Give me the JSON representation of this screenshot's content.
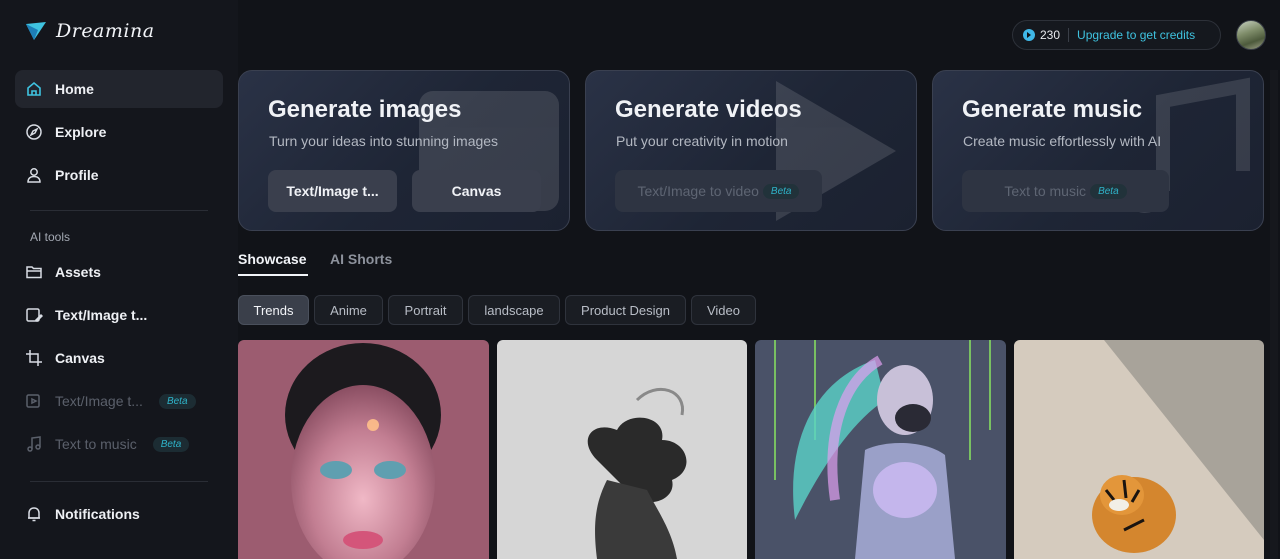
{
  "brand": {
    "name": "Dreamina"
  },
  "nav": {
    "home": "Home",
    "explore": "Explore",
    "profile": "Profile",
    "section_label": "AI tools",
    "assets": "Assets",
    "text_image": "Text/Image t...",
    "canvas": "Canvas",
    "text_image_video": "Text/Image t...",
    "text_music": "Text to music",
    "beta": "Beta",
    "notifications": "Notifications"
  },
  "account": {
    "credits": "230",
    "upgrade": "Upgrade to get credits"
  },
  "hero": {
    "images": {
      "title": "Generate images",
      "subtitle": "Turn your ideas into stunning images",
      "btn1": "Text/Image t...",
      "btn2": "Canvas"
    },
    "videos": {
      "title": "Generate videos",
      "subtitle": "Put your creativity in motion",
      "btn1": "Text/Image to video",
      "beta": "Beta"
    },
    "music": {
      "title": "Generate music",
      "subtitle": "Create music effortlessly with AI",
      "btn1": "Text to music",
      "beta": "Beta"
    }
  },
  "tabs": [
    "Showcase",
    "AI Shorts"
  ],
  "chips": [
    "Trends",
    "Anime",
    "Portrait",
    "landscape",
    "Product Design",
    "Video"
  ],
  "colors": {
    "accent": "#3fc3e0",
    "background": "#111318",
    "beta": "#2fb3c9"
  }
}
